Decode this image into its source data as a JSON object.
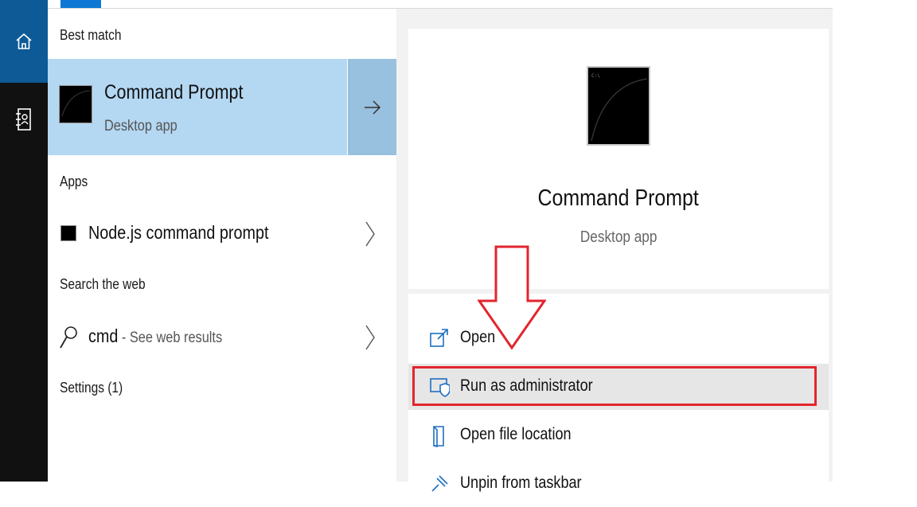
{
  "rail": {
    "home_icon": "home-icon",
    "notebook_icon": "notebook-icon"
  },
  "results": {
    "best_match_heading": "Best match",
    "best_match": {
      "title": "Command Prompt",
      "subtitle": "Desktop app",
      "icon": "command-prompt-icon",
      "arrow_icon": "arrow-right-icon"
    },
    "apps_heading": "Apps",
    "apps": [
      {
        "label": "Node.js command prompt",
        "icon": "nodejs-prompt-icon"
      }
    ],
    "web_heading": "Search the web",
    "web_result": {
      "query": "cmd",
      "suffix": " - See web results",
      "icon": "search-icon"
    },
    "settings_heading": "Settings (1)"
  },
  "details": {
    "title": "Command Prompt",
    "subtitle": "Desktop app",
    "actions": [
      {
        "label": "Open",
        "icon": "open-icon"
      },
      {
        "label": "Run as administrator",
        "icon": "shield-icon"
      },
      {
        "label": "Open file location",
        "icon": "file-location-icon"
      },
      {
        "label": "Unpin from taskbar",
        "icon": "unpin-icon"
      }
    ]
  },
  "colors": {
    "accent": "#0e78d4",
    "selected_bg": "#b4d7f2",
    "highlight_red": "#e3252d"
  }
}
